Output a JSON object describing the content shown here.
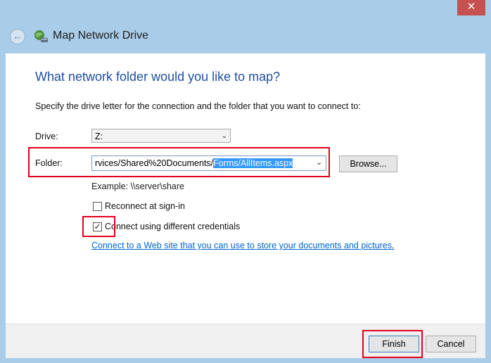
{
  "window": {
    "title": "Map Network Drive",
    "close_glyph": "✕"
  },
  "icons": {
    "back": "back-arrow-icon",
    "app": "network-drive-icon",
    "close": "close-icon"
  },
  "dialog": {
    "heading": "What network folder would you like to map?",
    "instruction": "Specify the drive letter for the connection and the folder that you want to connect to:",
    "drive_label": "Drive:",
    "drive_value": "Z:",
    "folder_label": "Folder:",
    "folder_value_plain": "rvices/Shared%20Documents/",
    "folder_value_selected": "Forms/AllItems.aspx",
    "browse_label": "Browse...",
    "example": "Example: \\\\server\\share",
    "reconnect_label": "Reconnect at sign-in",
    "reconnect_checked": false,
    "credentials_label": "Connect using different credentials",
    "credentials_checked": true,
    "web_link": "Connect to a Web site that you can use to store your documents and pictures",
    "web_link_suffix": "."
  },
  "footer": {
    "finish_label": "Finish",
    "cancel_label": "Cancel"
  },
  "colors": {
    "heading": "#1f4f9c",
    "link": "#0066cc",
    "selection": "#3399ff",
    "highlight": "#e3001b",
    "frame": "#a9cce8"
  }
}
